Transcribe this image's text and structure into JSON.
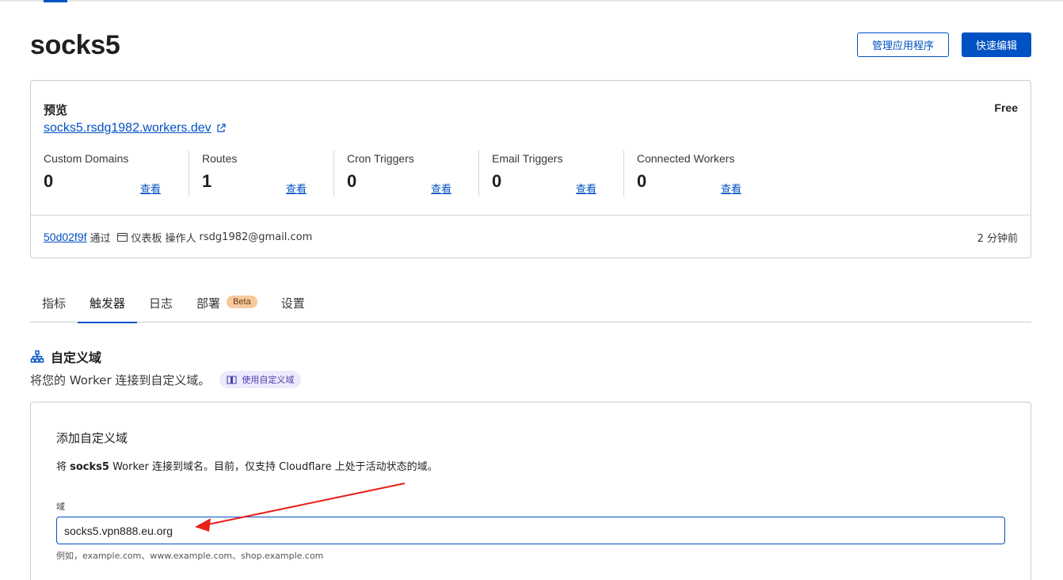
{
  "page": {
    "title": "socks5",
    "manage_button": "管理应用程序",
    "quick_edit_button": "快速编辑"
  },
  "overview": {
    "preview_label": "预览",
    "plan": "Free",
    "preview_url": "socks5.rsdg1982.workers.dev",
    "stats": [
      {
        "label": "Custom Domains",
        "value": "0",
        "view": "查看"
      },
      {
        "label": "Routes",
        "value": "1",
        "view": "查看"
      },
      {
        "label": "Cron Triggers",
        "value": "0",
        "view": "查看"
      },
      {
        "label": "Email Triggers",
        "value": "0",
        "view": "查看"
      },
      {
        "label": "Connected Workers",
        "value": "0",
        "view": "查看"
      }
    ],
    "deployment": {
      "hash": "50d02f9f",
      "via": "通过",
      "source": "仪表板",
      "operator_label": "操作人",
      "operator": "rsdg1982@gmail.com",
      "time": "2 分钟前"
    }
  },
  "tabs": [
    {
      "label": "指标",
      "active": false
    },
    {
      "label": "触发器",
      "active": true
    },
    {
      "label": "日志",
      "active": false
    },
    {
      "label": "部署",
      "active": false,
      "badge": "Beta"
    },
    {
      "label": "设置",
      "active": false
    }
  ],
  "custom_domains": {
    "icon": "sitemap-icon",
    "title": "自定义域",
    "description": "将您的 Worker 连接到自定义域。",
    "docs_link": "使用自定义域",
    "form": {
      "title": "添加自定义域",
      "desc_prefix": "将 ",
      "desc_worker": "socks5",
      "desc_suffix": " Worker 连接到域名。目前，仅支持 Cloudflare 上处于活动状态的域。",
      "field_label": "域",
      "field_value": "socks5.vpn888.eu.org",
      "field_hint": "例如，example.com、www.example.com、shop.example.com"
    }
  },
  "colors": {
    "accent": "#0051c3",
    "annotation_arrow": "#e8211a",
    "beta_badge": "#f7c99e"
  }
}
